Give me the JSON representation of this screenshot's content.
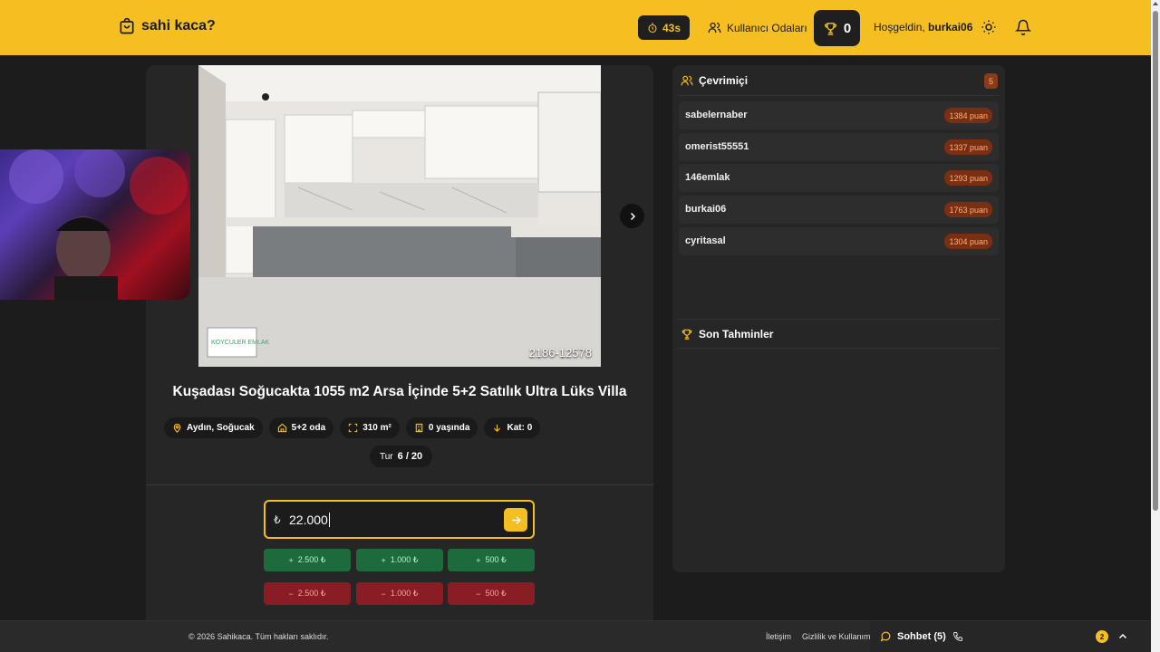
{
  "header": {
    "brand": "sahi kaca?",
    "timer": "43s",
    "rooms_label": "Kullanıcı Odaları",
    "score": "0",
    "greeting": "Hoşgeldin,",
    "username": "burkai06"
  },
  "listing": {
    "ref": "2186-12578",
    "title": "Kuşadası Soğucakta 1055 m2 Arsa İçinde 5+2 Satılık Ultra Lüks Villa",
    "chips": {
      "location": "Aydın, Soğucak",
      "rooms": "5+2 oda",
      "area": "310 m²",
      "age": "0 yaşında",
      "floor": "Kat: 0"
    },
    "round_label": "Tur",
    "round_value": "6 / 20",
    "logo_text": "KOYCULER EMLAK",
    "guess": {
      "currency": "₺",
      "value": "22.000"
    },
    "adjust": {
      "plus": [
        "2.500 ₺",
        "1.000 ₺",
        "500 ₺"
      ],
      "minus": [
        "2.500 ₺",
        "1.000 ₺",
        "500 ₺"
      ]
    }
  },
  "online": {
    "title": "Çevrimiçi",
    "count": "5",
    "users": [
      {
        "name": "sabelernaber",
        "points": "1384 puan"
      },
      {
        "name": "omerist55551",
        "points": "1337 puan"
      },
      {
        "name": "146emlak",
        "points": "1293 puan"
      },
      {
        "name": "burkai06",
        "points": "1763 puan"
      },
      {
        "name": "cyritasal",
        "points": "1304 puan"
      }
    ]
  },
  "recent": {
    "title": "Son Tahminler"
  },
  "footer": {
    "copyright": "© 2026 Sahikaca. Tüm hakları saklıdır.",
    "contact": "İletişim",
    "privacy": "Gizlilik ve Kullanım",
    "chat": "Sohbet (5)",
    "chat_badge": "2"
  },
  "colors": {
    "accent": "#f5bf22",
    "plus": "#1d6b3d",
    "minus": "#8a1c24"
  }
}
